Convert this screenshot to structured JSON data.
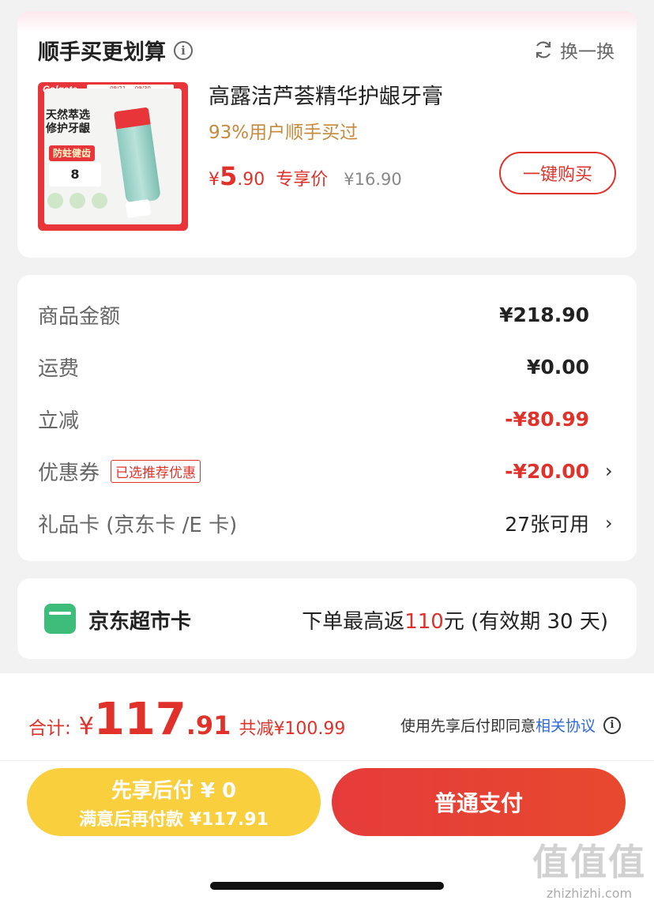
{
  "bundle": {
    "title": "顺手买更划算",
    "swap_label": "换一换",
    "product": {
      "image_brand": "Colgate",
      "image_dates": "09/21 — 09/30",
      "image_slogan_1": "天然萃选",
      "image_slogan_2": "修护牙龈",
      "image_tag": "防蛀健齿",
      "image_price": "8",
      "name": "高露洁芦荟精华护龈牙膏",
      "subtitle": "93%用户顺手买过",
      "price_currency": "¥",
      "price_int": "5",
      "price_dec": ".90",
      "price_tag": "专享价",
      "original_price": "¥16.90"
    },
    "buy_button": "一键购买"
  },
  "summary": {
    "rows": [
      {
        "label": "商品金额",
        "value": "¥218.90"
      },
      {
        "label": "运费",
        "value": "¥0.00"
      },
      {
        "label": "立减",
        "value": "-¥80.99"
      },
      {
        "label": "优惠券",
        "badge": "已选推荐优惠",
        "value": "-¥20.00",
        "chevron": "›"
      },
      {
        "label": "礼品卡 (京东卡 /E 卡)",
        "value": "27张可用",
        "chevron": "›"
      }
    ]
  },
  "market_card": {
    "title": "京东超市卡",
    "desc_prefix": "下单最高返",
    "desc_highlight": "110",
    "desc_suffix": "元 (有效期 30 天)"
  },
  "footer": {
    "total_label": "合计:",
    "total_currency": "¥",
    "total_int": "117",
    "total_dec": ".91",
    "saved": "共减¥100.99",
    "agree_prefix": "使用先享后付即同意",
    "agree_link": "相关协议",
    "later_line1": "先享后付 ¥ 0",
    "later_line2": "满意后再付款 ¥117.91",
    "pay_button": "普通支付"
  },
  "watermark": {
    "big": "值值值",
    "small": "zhizhizhi.com"
  },
  "colors": {
    "accent_red": "#e0322a",
    "gold": "#c58a3d",
    "yellow_button": "#f9cf3e",
    "link_blue": "#2d6ad8",
    "market_green": "#3dbd79"
  }
}
